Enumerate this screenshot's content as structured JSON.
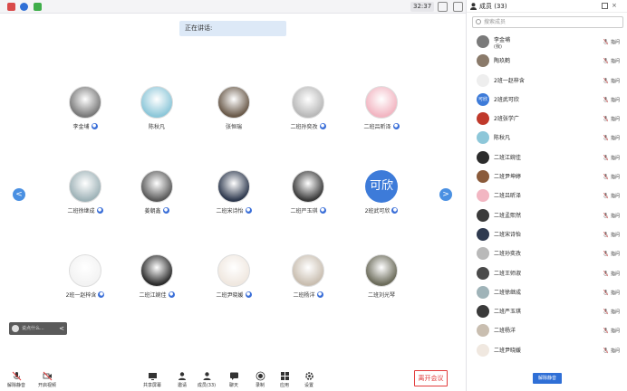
{
  "topbar": {
    "clock": "32:37"
  },
  "speaking": "正在讲话:",
  "grid": {
    "tiles": [
      {
        "name": "李金埔",
        "avatar": "photo",
        "color": "#7a7a7a",
        "mic": true
      },
      {
        "name": "陈秋凡",
        "avatar": "cartoon",
        "color": "#8dc7d9",
        "mic": false
      },
      {
        "name": "张恒瑞",
        "avatar": "photo",
        "color": "#6a5a4a",
        "mic": false
      },
      {
        "name": "二班孙奕孜",
        "avatar": "photo",
        "color": "#b9b9b9",
        "mic": true
      },
      {
        "name": "二班吕昕泽",
        "avatar": "cartoon",
        "color": "#f2b6c2",
        "mic": true
      },
      {
        "name": "二班徐继成",
        "avatar": "photo",
        "color": "#9fb3b8",
        "mic": true
      },
      {
        "name": "姜朝鑫",
        "avatar": "photo",
        "color": "#5a5a5a",
        "mic": true
      },
      {
        "name": "二班宋诗怡",
        "avatar": "photo",
        "color": "#2f3a4f",
        "mic": true
      },
      {
        "name": "二班严玉琪",
        "avatar": "photo",
        "color": "#3a3a3a",
        "mic": true
      },
      {
        "name": "2班武可欣",
        "avatar": "text",
        "text": "可欣",
        "color": "#3d7bd9",
        "mic": true
      },
      {
        "name": "2班一赵梓含",
        "avatar": "sketch",
        "color": "#f3f3f3",
        "mic": true
      },
      {
        "name": "二班江婉佳",
        "avatar": "photo",
        "color": "#2c2c2c",
        "mic": true
      },
      {
        "name": "二班尹晓媛",
        "avatar": "sketch",
        "color": "#f0e8e0",
        "mic": true
      },
      {
        "name": "二班杨洋",
        "avatar": "photo",
        "color": "#c9beb0",
        "mic": true
      },
      {
        "name": "二班刘光琴",
        "avatar": "photo",
        "color": "#6b6b5a",
        "mic": false
      }
    ]
  },
  "chat": {
    "placeholder": "说点什么...",
    "arrow": "<"
  },
  "nav": {
    "prev": "<",
    "next": ">",
    "color": "#4a90e2"
  },
  "toolbar": {
    "mute": "解除静音",
    "video": "开启视频",
    "share": "共享屏幕",
    "invite": "邀请",
    "members": "成员(33)",
    "chat": "聊天",
    "record": "录制",
    "apps": "应用",
    "settings": "设置",
    "leave": "离开会议"
  },
  "panel": {
    "title": "成员 (33)",
    "search_placeholder": "搜索成员",
    "unmute_all": "解除静音",
    "members": [
      {
        "name": "李金埔",
        "sub": "(我)",
        "color": "#7a7a7a",
        "label": "指问"
      },
      {
        "name": "陶玖鹤",
        "sub": "",
        "color": "#8a7a6a",
        "label": "指问"
      },
      {
        "name": "2班一赵梓含",
        "sub": "",
        "color": "#eeeeee",
        "label": "指问"
      },
      {
        "name": "2班武可欣",
        "sub": "",
        "color": "#3d7bd9",
        "text": "可欣",
        "label": "指问"
      },
      {
        "name": "2班张学广",
        "sub": "",
        "color": "#c0392b",
        "label": "指问"
      },
      {
        "name": "陈秋凡",
        "sub": "",
        "color": "#8dc7d9",
        "label": "指问"
      },
      {
        "name": "二班江婉佳",
        "sub": "",
        "color": "#2c2c2c",
        "label": "指问"
      },
      {
        "name": "二班尹坤婷",
        "sub": "",
        "color": "#8a5a3a",
        "label": "指问"
      },
      {
        "name": "二班吕昕泽",
        "sub": "",
        "color": "#f2b6c2",
        "label": "指问"
      },
      {
        "name": "二班孟熙然",
        "sub": "",
        "color": "#3a3a3a",
        "label": "指问"
      },
      {
        "name": "二班宋诗怡",
        "sub": "",
        "color": "#2f3a4f",
        "label": "指问"
      },
      {
        "name": "二班孙奕孜",
        "sub": "",
        "color": "#b9b9b9",
        "label": "指问"
      },
      {
        "name": "二班王师淑",
        "sub": "",
        "color": "#4a4a4a",
        "label": "指问"
      },
      {
        "name": "二班徐继成",
        "sub": "",
        "color": "#9fb3b8",
        "label": "指问"
      },
      {
        "name": "二班严玉琪",
        "sub": "",
        "color": "#3a3a3a",
        "label": "指问"
      },
      {
        "name": "二班杨洋",
        "sub": "",
        "color": "#c9beb0",
        "label": "指问"
      },
      {
        "name": "二班尹晓媛",
        "sub": "",
        "color": "#f0e8e0",
        "label": "指问"
      }
    ]
  }
}
